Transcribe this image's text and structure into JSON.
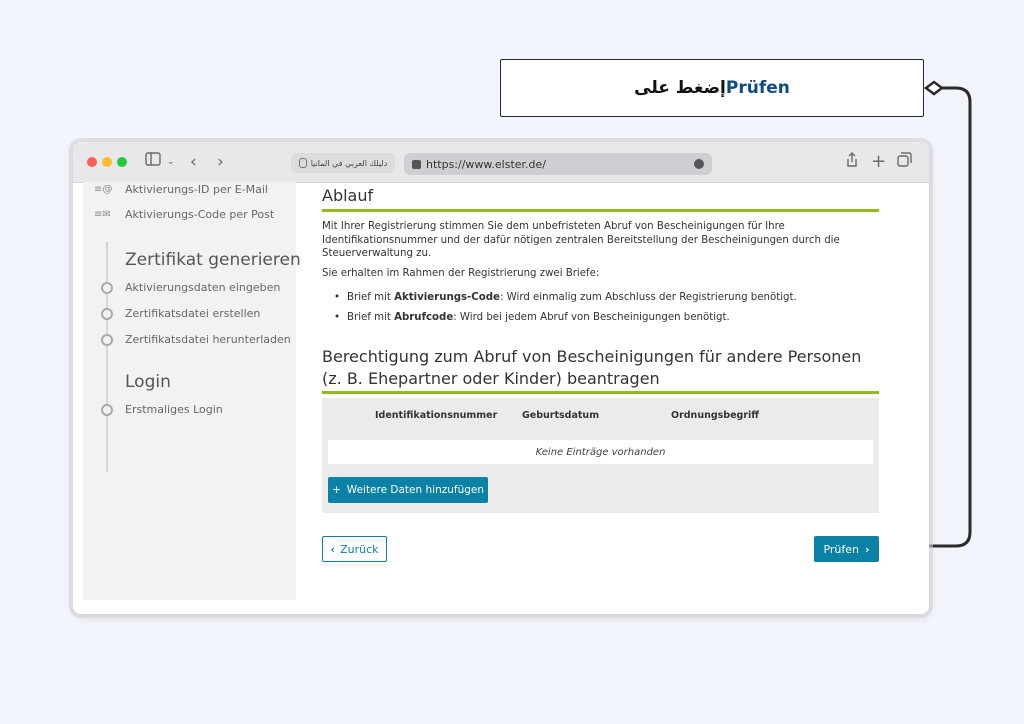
{
  "annotation": {
    "text_prefix": "إضغط على",
    "highlight": "Prüfen",
    "highlight_color": "#0d4a86"
  },
  "browser": {
    "tab_label": "دليلك العربي في المانيا",
    "url": "https://www.elster.de/"
  },
  "sidebar": {
    "top_items": [
      {
        "label": "Aktivierungs-ID per E-Mail",
        "icon": "email-at-icon"
      },
      {
        "label": "Aktivierungs-Code per Post",
        "icon": "mail-envelope-icon"
      }
    ],
    "sections": [
      {
        "heading": "Zertifikat generieren",
        "items": [
          "Aktivierungsdaten eingeben",
          "Zertifikatsdatei erstellen",
          "Zertifikatsdatei herunterladen"
        ]
      },
      {
        "heading": "Login",
        "items": [
          "Erstmaliges Login"
        ]
      }
    ]
  },
  "main": {
    "ablauf_title": "Ablauf",
    "intro": "Mit Ihrer Registrierung stimmen Sie dem unbefristeten Abruf von Bescheinigungen für Ihre Identifikationsnummer und der dafür nötigen zentralen Bereitstellung der Bescheinigungen durch die Steuerverwaltung zu.",
    "letters_intro": "Sie erhalten im Rahmen der Registrierung zwei Briefe:",
    "bullets": [
      {
        "prefix": "Brief mit ",
        "bold": "Aktivierungs-Code",
        "suffix": ": Wird einmalig zum Abschluss der Registrierung benötigt."
      },
      {
        "prefix": "Brief mit ",
        "bold": "Abrufcode",
        "suffix": ": Wird bei jedem Abruf von Bescheinigungen benötigt."
      }
    ],
    "section_title": "Berechtigung zum Abruf von Bescheinigungen für andere Personen (z. B. Ehepartner oder Kinder) beantragen",
    "table": {
      "columns": [
        "Identifikationsnummer",
        "Geburtsdatum",
        "Ordnungsbegriff"
      ],
      "empty_text": "Keine Einträge vorhanden"
    },
    "add_button": "Weitere Daten hinzufügen",
    "back_button": "Zurück",
    "next_button": "Prüfen"
  },
  "colors": {
    "accent_teal": "#0b81a5",
    "accent_green": "#8fbc1f"
  }
}
